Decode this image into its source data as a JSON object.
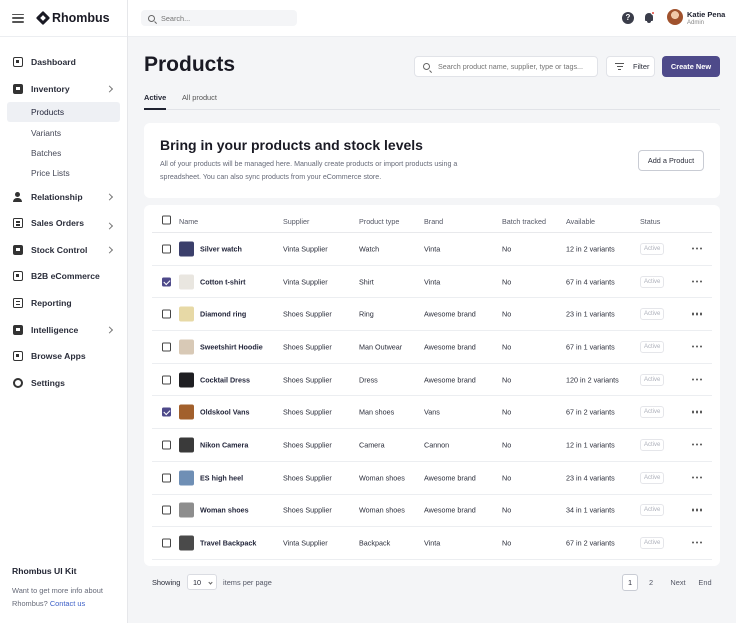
{
  "brand": {
    "name": "Rhombus"
  },
  "topbar": {
    "search_placeholder": "Search...",
    "help": "?",
    "user_name": "Katie Pena",
    "user_role": "Admin"
  },
  "sidebar": {
    "items": [
      {
        "label": "Dashboard",
        "icon": "grid-icon"
      },
      {
        "label": "Inventory",
        "icon": "box-icon"
      },
      {
        "label": "Relationship",
        "icon": "people-icon"
      },
      {
        "label": "Sales Orders",
        "icon": "document-icon"
      },
      {
        "label": "Stock Control",
        "icon": "box-icon"
      },
      {
        "label": "B2B eCommerce",
        "icon": "grid-icon"
      },
      {
        "label": "Reporting",
        "icon": "document-icon"
      },
      {
        "label": "Intelligence",
        "icon": "box-icon"
      },
      {
        "label": "Browse Apps",
        "icon": "grid-icon"
      },
      {
        "label": "Settings",
        "icon": "gear-icon"
      }
    ],
    "inventory_sub": [
      "Products",
      "Variants",
      "Batches",
      "Price Lists"
    ],
    "footer_title": "Rhombus UI Kit",
    "footer_text": "Want to get more info about Rhombus?",
    "footer_link": "Contact us"
  },
  "page": {
    "title": "Products",
    "search_placeholder": "Search product name, supplier, type or tags...",
    "filter_label": "Filter",
    "create_label": "Create New",
    "tabs": [
      "Active",
      "All product"
    ]
  },
  "banner": {
    "title": "Bring in your products and stock levels",
    "text": "All of your products will be managed here. Manually create products or import products using a spreadsheet. You can also sync products from your eCommerce store.",
    "button": "Add a Product"
  },
  "table": {
    "headers": {
      "name": "Name",
      "supplier": "Supplier",
      "type": "Product type",
      "brand": "Brand",
      "batch": "Batch tracked",
      "available": "Available",
      "status": "Status"
    },
    "rows": [
      {
        "name": "Silver watch",
        "supplier": "Vinta Supplier",
        "type": "Watch",
        "brand": "Vinta",
        "batch": "No",
        "available": "12 in 2 variants",
        "status": "Active",
        "checked": false,
        "thumb": "#3b3f6b"
      },
      {
        "name": "Cotton t-shirt",
        "supplier": "Vinta Supplier",
        "type": "Shirt",
        "brand": "Vinta",
        "batch": "No",
        "available": "67 in 4 variants",
        "status": "Active",
        "checked": true,
        "thumb": "#e9e6e0"
      },
      {
        "name": "Diamond ring",
        "supplier": "Shoes Supplier",
        "type": "Ring",
        "brand": "Awesome brand",
        "batch": "No",
        "available": "23 in 1 variants",
        "status": "Active",
        "checked": false,
        "thumb": "#e7d9a6"
      },
      {
        "name": "Sweetshirt Hoodie",
        "supplier": "Shoes Supplier",
        "type": "Man Outwear",
        "brand": "Awesome brand",
        "batch": "No",
        "available": "67 in 1 variants",
        "status": "Active",
        "checked": false,
        "thumb": "#d8c9b6"
      },
      {
        "name": "Cocktail Dress",
        "supplier": "Shoes Supplier",
        "type": "Dress",
        "brand": "Awesome brand",
        "batch": "No",
        "available": "120 in 2 variants",
        "status": "Active",
        "checked": false,
        "thumb": "#1e1e22"
      },
      {
        "name": "Oldskool Vans",
        "supplier": "Shoes Supplier",
        "type": "Man shoes",
        "brand": "Vans",
        "batch": "No",
        "available": "67 in 2 variants",
        "status": "Active",
        "checked": true,
        "thumb": "#a2602c"
      },
      {
        "name": "Nikon Camera",
        "supplier": "Shoes Supplier",
        "type": "Camera",
        "brand": "Cannon",
        "batch": "No",
        "available": "12 in 1 variants",
        "status": "Active",
        "checked": false,
        "thumb": "#3a3a3a"
      },
      {
        "name": "ES high heel",
        "supplier": "Shoes Supplier",
        "type": "Woman shoes",
        "brand": "Awesome brand",
        "batch": "No",
        "available": "23 in 4 variants",
        "status": "Active",
        "checked": false,
        "thumb": "#6f8fb5"
      },
      {
        "name": "Woman shoes",
        "supplier": "Shoes Supplier",
        "type": "Woman shoes",
        "brand": "Awesome brand",
        "batch": "No",
        "available": "34 in 1 variants",
        "status": "Active",
        "checked": false,
        "thumb": "#8d8d8d"
      },
      {
        "name": "Travel Backpack",
        "supplier": "Vinta Supplier",
        "type": "Backpack",
        "brand": "Vinta",
        "batch": "No",
        "available": "67 in 2 variants",
        "status": "Active",
        "checked": false,
        "thumb": "#4a4a4a"
      }
    ]
  },
  "pagination": {
    "showing": "Showing",
    "per_page_value": "10",
    "per_page_label": "items per page",
    "pages": [
      "1",
      "2"
    ],
    "next": "Next",
    "end": "End"
  },
  "colors": {
    "accent": "#4e4a8a"
  }
}
